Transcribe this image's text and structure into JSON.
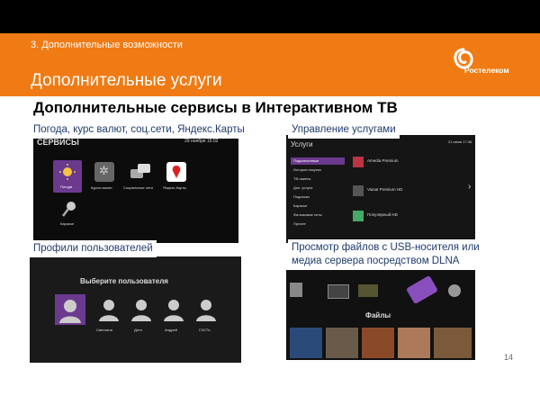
{
  "slide": {
    "section": "3. Дополнительные возможности",
    "title": "Дополнительные услуги",
    "logo_text": "Ростелеком",
    "heading": "Дополнительные сервисы в Интерактивном ТВ",
    "page_number": "14"
  },
  "captions": {
    "services": "Погода, курс валют, соц.сети, Яндекс.Карты",
    "manage": "Управление услугами",
    "profiles": "Профили пользователей",
    "files": "Просмотр файлов с USB-носителя или медиа сервера посредством DLNA"
  },
  "screen_services": {
    "title": "СЕРВИСЫ",
    "date": "29 ноября 15:02",
    "tiles": [
      "Погода",
      "Курсы валют",
      "Социальные сети",
      "Яндекс.Карты",
      "Караоке"
    ]
  },
  "screen_manage": {
    "title": "Услуги",
    "date": "21 июня 17:36",
    "menu": [
      "Подключенные",
      "История покупок",
      "ТВ-пакеты",
      "Доп. услуги",
      "Подписки",
      "Караоке",
      "Фильмовые сеты",
      "Прочее"
    ],
    "items": [
      "Amedia Premium",
      "Viasat Premium HD",
      "Популярный HD"
    ]
  },
  "screen_profiles": {
    "title": "Выберите пользователя",
    "users": [
      "Светлана",
      "Дети",
      "Андрей",
      "ГОСТЬ"
    ]
  },
  "screen_files": {
    "title": "Файлы"
  },
  "colors": {
    "orange": "#f07b14",
    "caption_blue": "#1f3b6e",
    "highlight_purple": "#6b3a8f"
  }
}
